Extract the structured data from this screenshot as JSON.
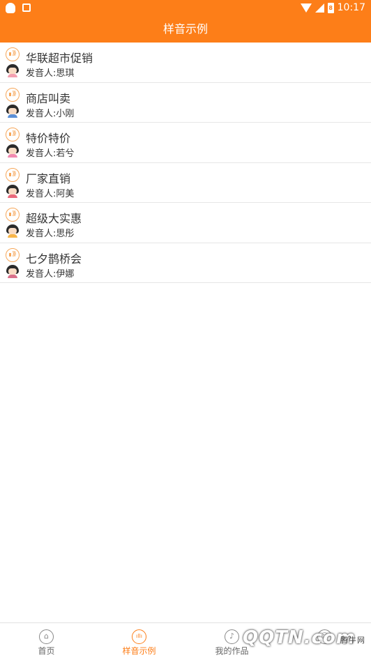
{
  "status_bar": {
    "time": "10:17",
    "battery_label": "8"
  },
  "header": {
    "title": "样音示例"
  },
  "samples": [
    {
      "title": "华联超市促销",
      "speaker": "发音人:思琪",
      "avatar_color": "#f4a0b0"
    },
    {
      "title": "商店叫卖",
      "speaker": "发音人:小刚",
      "avatar_color": "#5b8fd6"
    },
    {
      "title": "特价特价",
      "speaker": "发音人:若兮",
      "avatar_color": "#f28ab0"
    },
    {
      "title": "厂家直销",
      "speaker": "发音人:阿美",
      "avatar_color": "#e96a7c"
    },
    {
      "title": "超级大实惠",
      "speaker": "发音人:思彤",
      "avatar_color": "#f7b54a"
    },
    {
      "title": "七夕鹊桥会",
      "speaker": "发音人:伊娜",
      "avatar_color": "#d9708a"
    }
  ],
  "tabs": [
    {
      "label": "首页",
      "icon": "home-icon",
      "glyph": "⌂"
    },
    {
      "label": "样音示例",
      "icon": "waveform-icon",
      "glyph": "ıllı"
    },
    {
      "label": "我的作品",
      "icon": "works-icon",
      "glyph": "♪"
    },
    {
      "label": "",
      "icon": "profile-icon",
      "glyph": "☺"
    }
  ],
  "watermark": {
    "text": "QQTN.com",
    "small": "腾牛网"
  },
  "colors": {
    "accent": "#fd7e18",
    "divider": "#e6e6e6",
    "text": "#333333"
  }
}
